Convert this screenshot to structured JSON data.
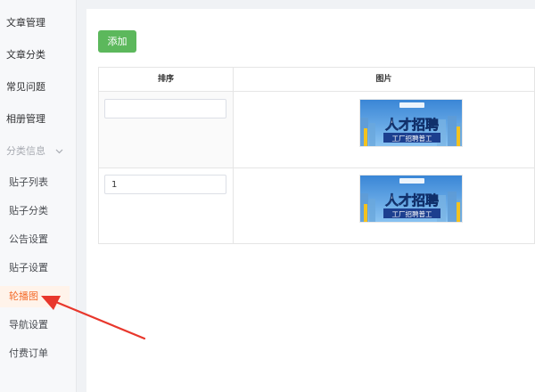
{
  "sidebar": {
    "items": [
      {
        "label": "文章管理",
        "type": "top"
      },
      {
        "label": "文章分类",
        "type": "top"
      },
      {
        "label": "常见问题",
        "type": "top"
      },
      {
        "label": "相册管理",
        "type": "top"
      },
      {
        "label": "分类信息",
        "type": "group"
      },
      {
        "label": "贴子列表",
        "type": "sub"
      },
      {
        "label": "贴子分类",
        "type": "sub"
      },
      {
        "label": "公告设置",
        "type": "sub"
      },
      {
        "label": "贴子设置",
        "type": "sub"
      },
      {
        "label": "轮播图",
        "type": "sub",
        "active": true
      },
      {
        "label": "导航设置",
        "type": "sub"
      },
      {
        "label": "付费订单",
        "type": "sub"
      }
    ]
  },
  "toolbar": {
    "add_label": "添加"
  },
  "table": {
    "headers": [
      "排序",
      "图片"
    ],
    "rows": [
      {
        "sort": "",
        "banner_title": "人才招聘",
        "banner_subtitle": "工厂招聘普工"
      },
      {
        "sort": "1",
        "banner_title": "人才招聘",
        "banner_subtitle": "工厂招聘普工"
      }
    ]
  },
  "colors": {
    "accent": "#f46c2b",
    "add_button": "#5cb85c",
    "annotation_arrow": "#e8372c"
  }
}
